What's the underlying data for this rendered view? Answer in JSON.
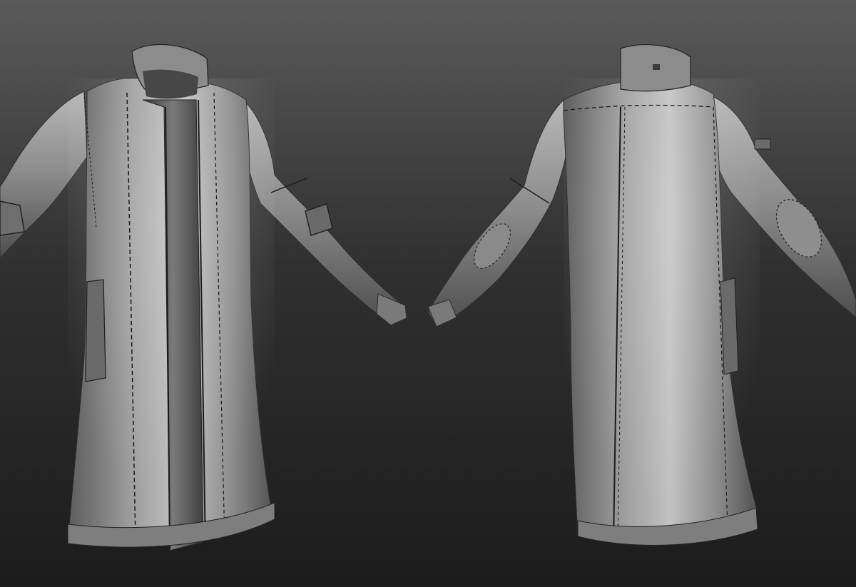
{
  "scene": {
    "background": {
      "top": "#5a5a5a",
      "mid": "#303030",
      "bottom": "#1c1c1c"
    },
    "material": {
      "highlight": "#d9d9d9",
      "base": "#8f8f8f",
      "shadow": "#3a3a3a",
      "stitch": "#1a1a1a"
    },
    "views": [
      "front-view",
      "back-view"
    ]
  }
}
